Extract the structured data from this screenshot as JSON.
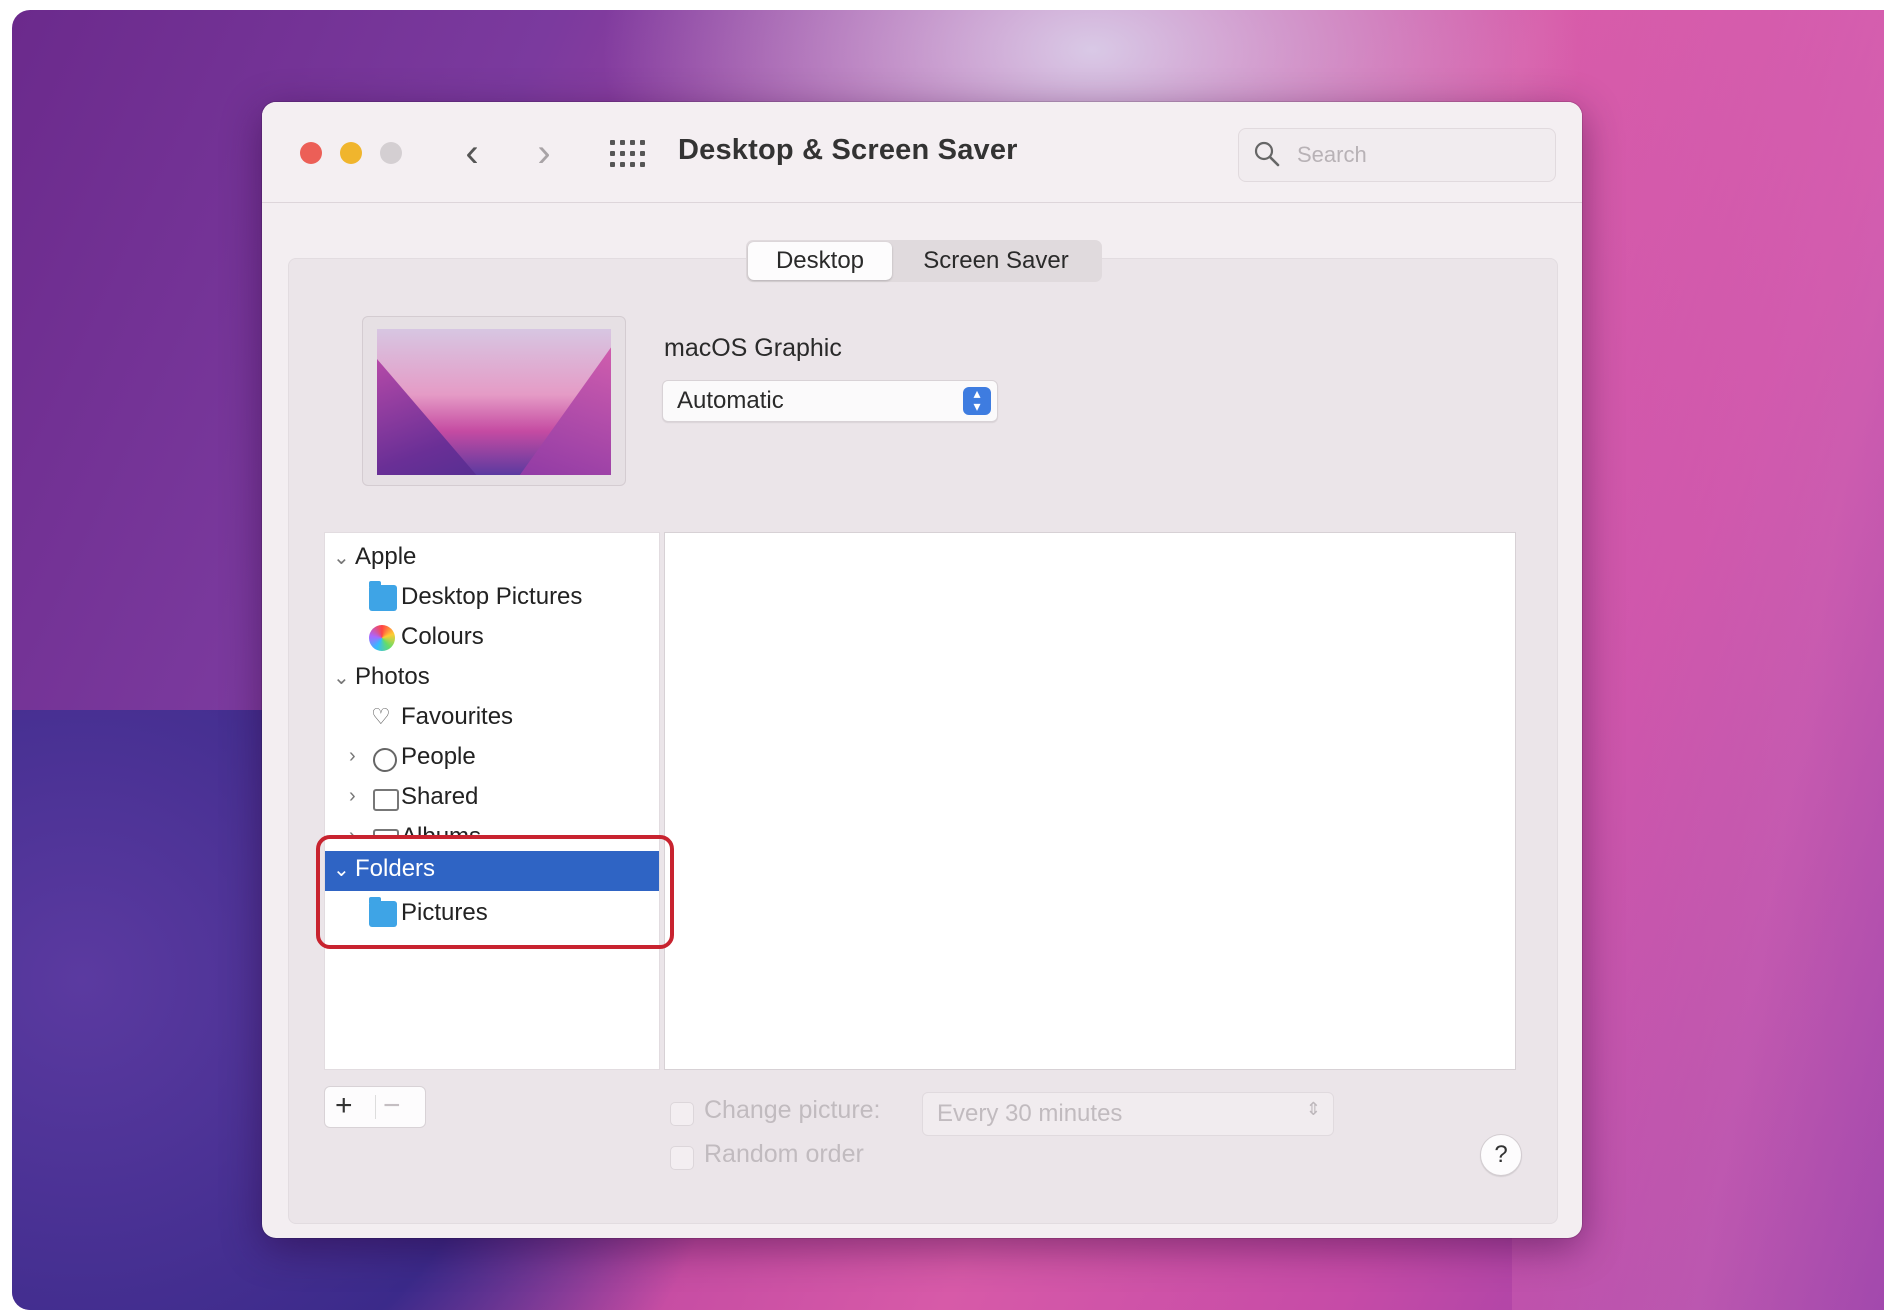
{
  "window": {
    "title": "Desktop & Screen Saver",
    "search_placeholder": "Search",
    "back_glyph": "‹",
    "forward_glyph": "›"
  },
  "tabs": [
    {
      "label": "Desktop",
      "active": true
    },
    {
      "label": "Screen Saver",
      "active": false
    }
  ],
  "current_picture": {
    "name": "macOS Graphic",
    "mode": "Automatic"
  },
  "sidebar": {
    "apple": {
      "label": "Apple",
      "disclosure": "⌄"
    },
    "desktop_pictures": {
      "label": "Desktop Pictures",
      "icon": "folder-icon"
    },
    "colours": {
      "label": "Colours",
      "icon": "color-wheel-icon"
    },
    "photos": {
      "label": "Photos",
      "disclosure": "⌄"
    },
    "favourites": {
      "label": "Favourites",
      "icon": "heart-icon"
    },
    "people": {
      "label": "People",
      "icon": "person-circle-icon",
      "disclosure": "›"
    },
    "shared": {
      "label": "Shared",
      "icon": "shared-album-icon",
      "disclosure": "›"
    },
    "albums": {
      "label": "Albums",
      "icon": "album-icon",
      "disclosure": "›"
    },
    "folders": {
      "label": "Folders",
      "disclosure": "⌄",
      "selected": true
    },
    "pictures": {
      "label": "Pictures",
      "icon": "folder-icon"
    }
  },
  "bottom": {
    "add_label": "+",
    "remove_label": "−",
    "change_picture_label": "Change picture:",
    "interval_value": "Every 30 minutes",
    "random_order_label": "Random order",
    "help_label": "?"
  },
  "colors": {
    "selection": "#2f64c4",
    "highlight_box": "#c8232f",
    "close": "#ec5f57",
    "minimize": "#f0b52d"
  }
}
